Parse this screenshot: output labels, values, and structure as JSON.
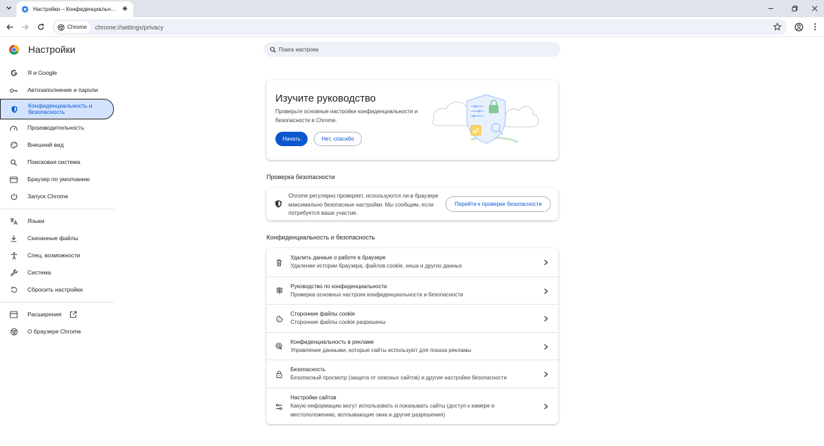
{
  "browser": {
    "tab": {
      "title": "Настройки – Конфиденциальн…",
      "favicon": "gear-icon"
    },
    "omnibox": {
      "chip_label": "Chrome",
      "url": "chrome://settings/privacy"
    }
  },
  "header": {
    "title": "Настройки",
    "search_placeholder": "Поиск настроек"
  },
  "sidebar": {
    "items": [
      {
        "label": "Я и Google",
        "icon": "google-icon"
      },
      {
        "label": "Автозаполнение и пароли",
        "icon": "key-icon"
      },
      {
        "label": "Конфиденциальность и безопасность",
        "icon": "shield-icon",
        "active": true
      },
      {
        "label": "Производительность",
        "icon": "speedometer-icon"
      },
      {
        "label": "Внешний вид",
        "icon": "palette-icon"
      },
      {
        "label": "Поисковая система",
        "icon": "search-icon"
      },
      {
        "label": "Браузер по умолчанию",
        "icon": "browser-window-icon"
      },
      {
        "label": "Запуск Chrome",
        "icon": "power-icon"
      },
      {
        "label": "Языки",
        "icon": "translate-icon"
      },
      {
        "label": "Скачанные файлы",
        "icon": "download-icon"
      },
      {
        "label": "Спец. возможности",
        "icon": "accessibility-icon"
      },
      {
        "label": "Система",
        "icon": "wrench-icon"
      },
      {
        "label": "Сбросить настройки",
        "icon": "reset-icon"
      },
      {
        "label": "Расширения",
        "icon": "puzzle-icon"
      },
      {
        "label": "О браузере Chrome",
        "icon": "chrome-icon"
      }
    ]
  },
  "guide": {
    "title": "Изучите руководство",
    "description": "Проверьте основные настройки конфиденциальности и безопасности в Chrome.",
    "start_label": "Начать",
    "dismiss_label": "Нет, спасибо"
  },
  "safety_check": {
    "section_title": "Проверка безопасности",
    "text": "Chrome регулярно проверяет, используются ли в браузере максимально безопасные настройки. Мы сообщим, если потребуется ваше участие.",
    "button_label": "Перейти к проверке безопасности"
  },
  "privacy": {
    "section_title": "Конфиденциальность и безопасность",
    "rows": [
      {
        "title": "Удалить данные о работе в браузере",
        "subtitle": "Удаление истории браузера, файлов cookie, кеша и других данных",
        "icon": "trash-icon"
      },
      {
        "title": "Руководство по конфиденциальности",
        "subtitle": "Проверка основных настроек конфиденциальности и безопасности",
        "icon": "signpost-icon"
      },
      {
        "title": "Сторонние файлы cookie",
        "subtitle": "Сторонние файлы cookie разрешены",
        "icon": "cookie-icon"
      },
      {
        "title": "Конфиденциальность в рекламе",
        "subtitle": "Управление данными, которые сайты используют для показа рекламы",
        "icon": "ad-privacy-icon"
      },
      {
        "title": "Безопасность",
        "subtitle": "Безопасный просмотр (защита от опасных сайтов) и другие настройки безопасности",
        "icon": "lock-icon"
      },
      {
        "title": "Настройки сайтов",
        "subtitle": "Какую информацию могут использовать и показывать сайты (доступ к камере и местоположению, всплывающие окна и другие разрешения)",
        "icon": "sliders-icon"
      }
    ]
  },
  "colors": {
    "accent": "#0b57d0",
    "active_nav_bg": "#d3e3fd",
    "tabstrip_bg": "#dfe3eb",
    "omnibox_bg": "#eef1f8"
  }
}
